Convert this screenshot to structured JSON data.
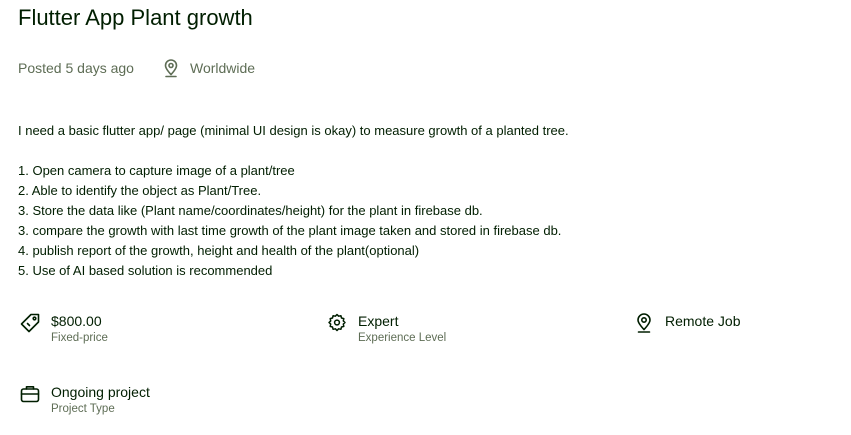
{
  "job": {
    "title": "Flutter App Plant growth",
    "posted": "Posted 5 days ago",
    "location": "Worldwide",
    "description_intro": "I need a basic flutter app/ page (minimal UI design is okay) to measure growth of a planted tree.",
    "description_items": [
      "1. Open camera to capture image of a plant/tree",
      "2. Able to identify the object as Plant/Tree.",
      "3. Store the data like (Plant name/coordinates/height) for the plant in firebase db.",
      "3. compare the growth with last time growth of the plant image taken and stored in firebase db.",
      "4. publish report of the growth, height and health of the plant(optional)",
      "5. Use of AI based solution is recommended"
    ]
  },
  "features": {
    "price": {
      "value": "$800.00",
      "label": "Fixed-price",
      "icon": "price-tag-icon"
    },
    "level": {
      "value": "Expert",
      "label": "Experience Level",
      "icon": "expertise-gear-icon"
    },
    "remote": {
      "value": "Remote Job",
      "icon": "location-pin-icon"
    },
    "project": {
      "value": "Ongoing project",
      "label": "Project Type",
      "icon": "briefcase-icon"
    }
  },
  "icons": {
    "location": "location-pin-icon"
  },
  "colors": {
    "text_primary": "#001e00",
    "text_secondary": "#5e6d55"
  }
}
